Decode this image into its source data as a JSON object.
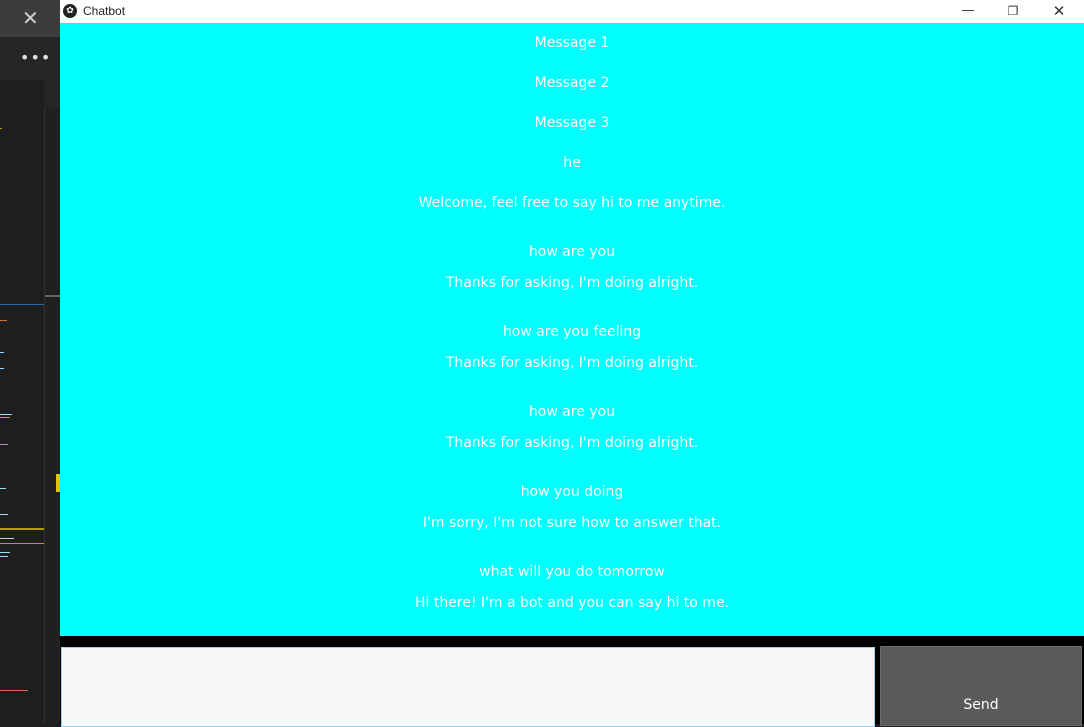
{
  "window": {
    "title": "Chatbot",
    "controls": {
      "minimize": "—",
      "maximize": "❐",
      "close": "✕"
    }
  },
  "background_editor": {
    "close_glyph": "✕",
    "menu_glyph": "•••"
  },
  "messages": [
    {
      "text": "Message 1"
    },
    {
      "text": "Message 2"
    },
    {
      "text": "Message 3"
    },
    {
      "text": "he"
    },
    {
      "text": "Welcome, feel free to say hi to me anytime."
    },
    {
      "text": "how are you"
    },
    {
      "text": "Thanks for asking, I'm doing alright."
    },
    {
      "text": "how are you feeling"
    },
    {
      "text": "Thanks for asking, I'm doing alright."
    },
    {
      "text": "how are you"
    },
    {
      "text": "Thanks for asking, I'm doing alright."
    },
    {
      "text": "how you doing"
    },
    {
      "text": "I'm sorry, I'm not sure how to answer that."
    },
    {
      "text": "what will you do tomorrow"
    },
    {
      "text": "Hi there! I'm a bot and you can say hi to me."
    }
  ],
  "input": {
    "value": ""
  },
  "send_button": {
    "label": "Send"
  },
  "colors": {
    "chat_background": "#00ffff",
    "message_text": "#ffffff",
    "send_button": "#5a5a5a",
    "input_background": "#f7f7f7"
  }
}
